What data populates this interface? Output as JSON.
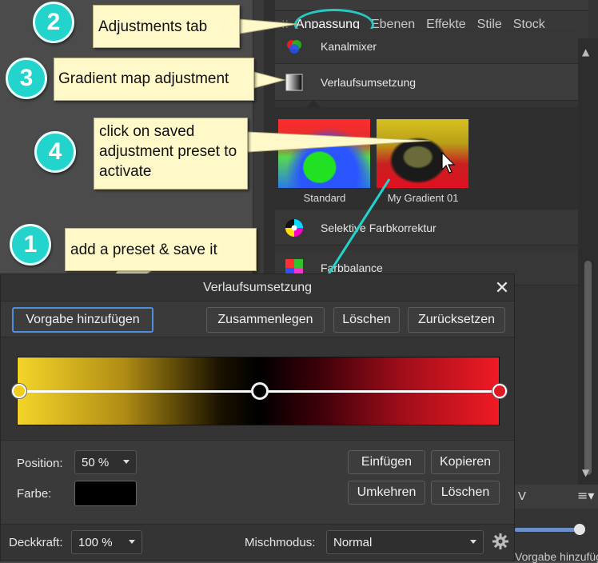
{
  "panel": {
    "tabs": [
      "Anpassung",
      "Ebenen",
      "Effekte",
      "Stile",
      "Stock"
    ],
    "active_tab": "Anpassung",
    "adjustments": {
      "kanalmixer": "Kanalmixer",
      "verlauf": "Verlaufsumsetzung",
      "selektiv": "Selektive Farbkorrektur",
      "farbbalance": "Farbbalance"
    },
    "presets": [
      {
        "label": "Standard"
      },
      {
        "label": "My Gradient 01"
      }
    ]
  },
  "callouts": [
    {
      "num": "1",
      "text": "add a preset & save it"
    },
    {
      "num": "2",
      "text": "Adjustments tab"
    },
    {
      "num": "3",
      "text": "Gradient map adjustment"
    },
    {
      "num": "4",
      "text": "click on saved adjustment preset to activate"
    }
  ],
  "dialog": {
    "title": "Verlaufsumsetzung",
    "buttons": {
      "add_preset": "Vorgabe hinzufügen",
      "merge": "Zusammenlegen",
      "delete": "Löschen",
      "reset": "Zurücksetzen",
      "insert": "Einfügen",
      "copy": "Kopieren",
      "reverse": "Umkehren",
      "delete_stop": "Löschen"
    },
    "gradient": {
      "stops": [
        {
          "position": 0,
          "color": "#f2cc1e"
        },
        {
          "position": 0.5,
          "color": "#000000"
        },
        {
          "position": 1,
          "color": "#e01a24"
        }
      ]
    },
    "position_label": "Position:",
    "position_value": "50 %",
    "color_label": "Farbe:",
    "color_value": "#000000",
    "opacity_label": "Deckkraft:",
    "opacity_value": "100 %",
    "blend_label": "Mischmodus:",
    "blend_value": "Normal"
  },
  "background": {
    "v_label": "V",
    "cut_text": "Vorgabe hinzufügen"
  },
  "colors": {
    "accent": "#22d4cb",
    "callout_bg": "#fff8c8",
    "focus": "#4d8fdc"
  }
}
